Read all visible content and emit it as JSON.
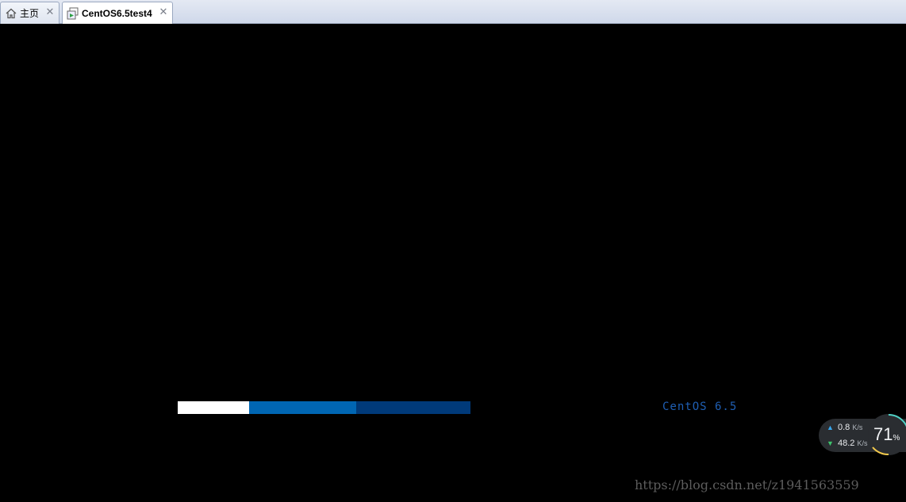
{
  "tabs": [
    {
      "label": "主页",
      "icon": "home-icon",
      "close": "✕"
    },
    {
      "label": "CentOS6.5test4",
      "icon": "vm-icon",
      "close": "✕"
    }
  ],
  "boot": {
    "os_label": "CentOS 6.5",
    "progress_colors": {
      "white": "#ffffff",
      "blue": "#0066b3",
      "dark": "#003a7a"
    }
  },
  "network": {
    "upload_value": "0.8",
    "upload_unit": "K/s",
    "download_value": "48.2",
    "download_unit": "K/s",
    "cpu_value": "71",
    "cpu_unit": "%"
  },
  "watermark": "https://blog.csdn.net/z1941563559"
}
